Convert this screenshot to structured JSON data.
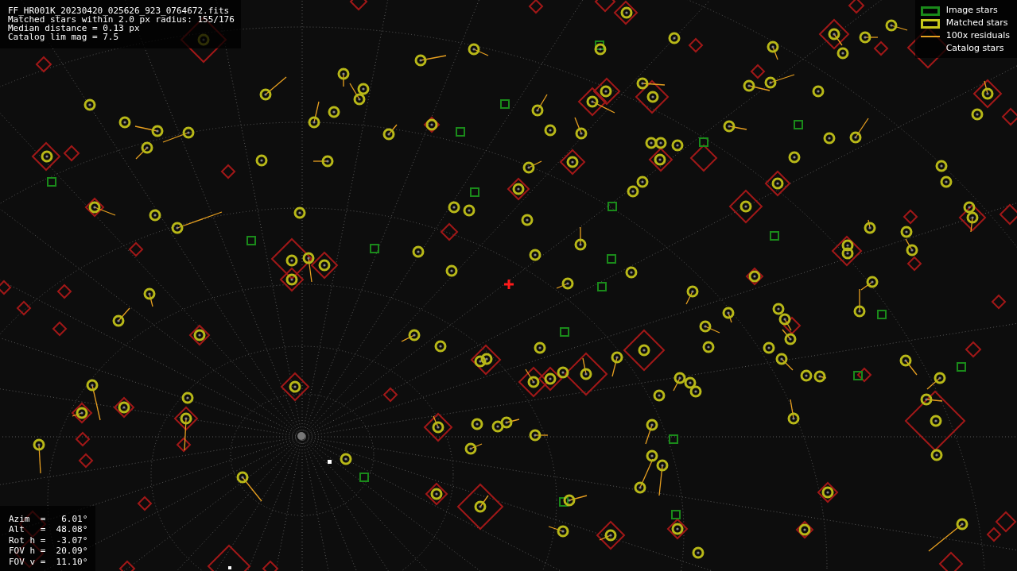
{
  "info_lines": [
    "FF_HR001K_20230420_025626_923_0764672.fits",
    "Matched stars within 2.0 px radius: 155/176",
    "Median distance = 0.13 px",
    "Catalog lim mag = 7.5"
  ],
  "legend": [
    {
      "kind": "image",
      "label": "Image stars"
    },
    {
      "kind": "matched",
      "label": "Matched stars"
    },
    {
      "kind": "residual",
      "label": "100x residuals"
    },
    {
      "kind": "catalog",
      "label": "Catalog stars"
    }
  ],
  "pointing_lines": [
    "Azim  =   6.01°",
    "Alt   =  48.08°",
    "Rot h =  -3.07°",
    "FOV h =  20.09°",
    "FOV v =  11.10°"
  ]
}
